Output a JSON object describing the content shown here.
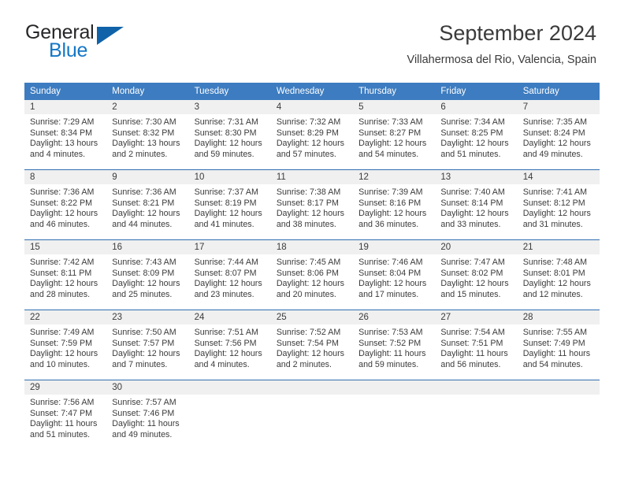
{
  "logo": {
    "word_one": "General",
    "word_two": "Blue",
    "triangle_icon": "triangle-icon"
  },
  "header": {
    "title": "September 2024",
    "location": "Villahermosa del Rio, Valencia, Spain"
  },
  "colors": {
    "header_blue": "#3d7cc0",
    "row_divider_blue": "#2f6fb0",
    "daynum_band": "#f0f0f0",
    "logo_blue": "#1477c6",
    "text": "#3b3b3b"
  },
  "weekday_headers": [
    "Sunday",
    "Monday",
    "Tuesday",
    "Wednesday",
    "Thursday",
    "Friday",
    "Saturday"
  ],
  "weeks": [
    [
      {
        "day": "1",
        "sunrise": "Sunrise: 7:29 AM",
        "sunset": "Sunset: 8:34 PM",
        "daylight_line1": "Daylight: 13 hours",
        "daylight_line2": "and 4 minutes."
      },
      {
        "day": "2",
        "sunrise": "Sunrise: 7:30 AM",
        "sunset": "Sunset: 8:32 PM",
        "daylight_line1": "Daylight: 13 hours",
        "daylight_line2": "and 2 minutes."
      },
      {
        "day": "3",
        "sunrise": "Sunrise: 7:31 AM",
        "sunset": "Sunset: 8:30 PM",
        "daylight_line1": "Daylight: 12 hours",
        "daylight_line2": "and 59 minutes."
      },
      {
        "day": "4",
        "sunrise": "Sunrise: 7:32 AM",
        "sunset": "Sunset: 8:29 PM",
        "daylight_line1": "Daylight: 12 hours",
        "daylight_line2": "and 57 minutes."
      },
      {
        "day": "5",
        "sunrise": "Sunrise: 7:33 AM",
        "sunset": "Sunset: 8:27 PM",
        "daylight_line1": "Daylight: 12 hours",
        "daylight_line2": "and 54 minutes."
      },
      {
        "day": "6",
        "sunrise": "Sunrise: 7:34 AM",
        "sunset": "Sunset: 8:25 PM",
        "daylight_line1": "Daylight: 12 hours",
        "daylight_line2": "and 51 minutes."
      },
      {
        "day": "7",
        "sunrise": "Sunrise: 7:35 AM",
        "sunset": "Sunset: 8:24 PM",
        "daylight_line1": "Daylight: 12 hours",
        "daylight_line2": "and 49 minutes."
      }
    ],
    [
      {
        "day": "8",
        "sunrise": "Sunrise: 7:36 AM",
        "sunset": "Sunset: 8:22 PM",
        "daylight_line1": "Daylight: 12 hours",
        "daylight_line2": "and 46 minutes."
      },
      {
        "day": "9",
        "sunrise": "Sunrise: 7:36 AM",
        "sunset": "Sunset: 8:21 PM",
        "daylight_line1": "Daylight: 12 hours",
        "daylight_line2": "and 44 minutes."
      },
      {
        "day": "10",
        "sunrise": "Sunrise: 7:37 AM",
        "sunset": "Sunset: 8:19 PM",
        "daylight_line1": "Daylight: 12 hours",
        "daylight_line2": "and 41 minutes."
      },
      {
        "day": "11",
        "sunrise": "Sunrise: 7:38 AM",
        "sunset": "Sunset: 8:17 PM",
        "daylight_line1": "Daylight: 12 hours",
        "daylight_line2": "and 38 minutes."
      },
      {
        "day": "12",
        "sunrise": "Sunrise: 7:39 AM",
        "sunset": "Sunset: 8:16 PM",
        "daylight_line1": "Daylight: 12 hours",
        "daylight_line2": "and 36 minutes."
      },
      {
        "day": "13",
        "sunrise": "Sunrise: 7:40 AM",
        "sunset": "Sunset: 8:14 PM",
        "daylight_line1": "Daylight: 12 hours",
        "daylight_line2": "and 33 minutes."
      },
      {
        "day": "14",
        "sunrise": "Sunrise: 7:41 AM",
        "sunset": "Sunset: 8:12 PM",
        "daylight_line1": "Daylight: 12 hours",
        "daylight_line2": "and 31 minutes."
      }
    ],
    [
      {
        "day": "15",
        "sunrise": "Sunrise: 7:42 AM",
        "sunset": "Sunset: 8:11 PM",
        "daylight_line1": "Daylight: 12 hours",
        "daylight_line2": "and 28 minutes."
      },
      {
        "day": "16",
        "sunrise": "Sunrise: 7:43 AM",
        "sunset": "Sunset: 8:09 PM",
        "daylight_line1": "Daylight: 12 hours",
        "daylight_line2": "and 25 minutes."
      },
      {
        "day": "17",
        "sunrise": "Sunrise: 7:44 AM",
        "sunset": "Sunset: 8:07 PM",
        "daylight_line1": "Daylight: 12 hours",
        "daylight_line2": "and 23 minutes."
      },
      {
        "day": "18",
        "sunrise": "Sunrise: 7:45 AM",
        "sunset": "Sunset: 8:06 PM",
        "daylight_line1": "Daylight: 12 hours",
        "daylight_line2": "and 20 minutes."
      },
      {
        "day": "19",
        "sunrise": "Sunrise: 7:46 AM",
        "sunset": "Sunset: 8:04 PM",
        "daylight_line1": "Daylight: 12 hours",
        "daylight_line2": "and 17 minutes."
      },
      {
        "day": "20",
        "sunrise": "Sunrise: 7:47 AM",
        "sunset": "Sunset: 8:02 PM",
        "daylight_line1": "Daylight: 12 hours",
        "daylight_line2": "and 15 minutes."
      },
      {
        "day": "21",
        "sunrise": "Sunrise: 7:48 AM",
        "sunset": "Sunset: 8:01 PM",
        "daylight_line1": "Daylight: 12 hours",
        "daylight_line2": "and 12 minutes."
      }
    ],
    [
      {
        "day": "22",
        "sunrise": "Sunrise: 7:49 AM",
        "sunset": "Sunset: 7:59 PM",
        "daylight_line1": "Daylight: 12 hours",
        "daylight_line2": "and 10 minutes."
      },
      {
        "day": "23",
        "sunrise": "Sunrise: 7:50 AM",
        "sunset": "Sunset: 7:57 PM",
        "daylight_line1": "Daylight: 12 hours",
        "daylight_line2": "and 7 minutes."
      },
      {
        "day": "24",
        "sunrise": "Sunrise: 7:51 AM",
        "sunset": "Sunset: 7:56 PM",
        "daylight_line1": "Daylight: 12 hours",
        "daylight_line2": "and 4 minutes."
      },
      {
        "day": "25",
        "sunrise": "Sunrise: 7:52 AM",
        "sunset": "Sunset: 7:54 PM",
        "daylight_line1": "Daylight: 12 hours",
        "daylight_line2": "and 2 minutes."
      },
      {
        "day": "26",
        "sunrise": "Sunrise: 7:53 AM",
        "sunset": "Sunset: 7:52 PM",
        "daylight_line1": "Daylight: 11 hours",
        "daylight_line2": "and 59 minutes."
      },
      {
        "day": "27",
        "sunrise": "Sunrise: 7:54 AM",
        "sunset": "Sunset: 7:51 PM",
        "daylight_line1": "Daylight: 11 hours",
        "daylight_line2": "and 56 minutes."
      },
      {
        "day": "28",
        "sunrise": "Sunrise: 7:55 AM",
        "sunset": "Sunset: 7:49 PM",
        "daylight_line1": "Daylight: 11 hours",
        "daylight_line2": "and 54 minutes."
      }
    ],
    [
      {
        "day": "29",
        "sunrise": "Sunrise: 7:56 AM",
        "sunset": "Sunset: 7:47 PM",
        "daylight_line1": "Daylight: 11 hours",
        "daylight_line2": "and 51 minutes."
      },
      {
        "day": "30",
        "sunrise": "Sunrise: 7:57 AM",
        "sunset": "Sunset: 7:46 PM",
        "daylight_line1": "Daylight: 11 hours",
        "daylight_line2": "and 49 minutes."
      },
      {
        "day": "",
        "sunrise": "",
        "sunset": "",
        "daylight_line1": "",
        "daylight_line2": ""
      },
      {
        "day": "",
        "sunrise": "",
        "sunset": "",
        "daylight_line1": "",
        "daylight_line2": ""
      },
      {
        "day": "",
        "sunrise": "",
        "sunset": "",
        "daylight_line1": "",
        "daylight_line2": ""
      },
      {
        "day": "",
        "sunrise": "",
        "sunset": "",
        "daylight_line1": "",
        "daylight_line2": ""
      },
      {
        "day": "",
        "sunrise": "",
        "sunset": "",
        "daylight_line1": "",
        "daylight_line2": ""
      }
    ]
  ]
}
